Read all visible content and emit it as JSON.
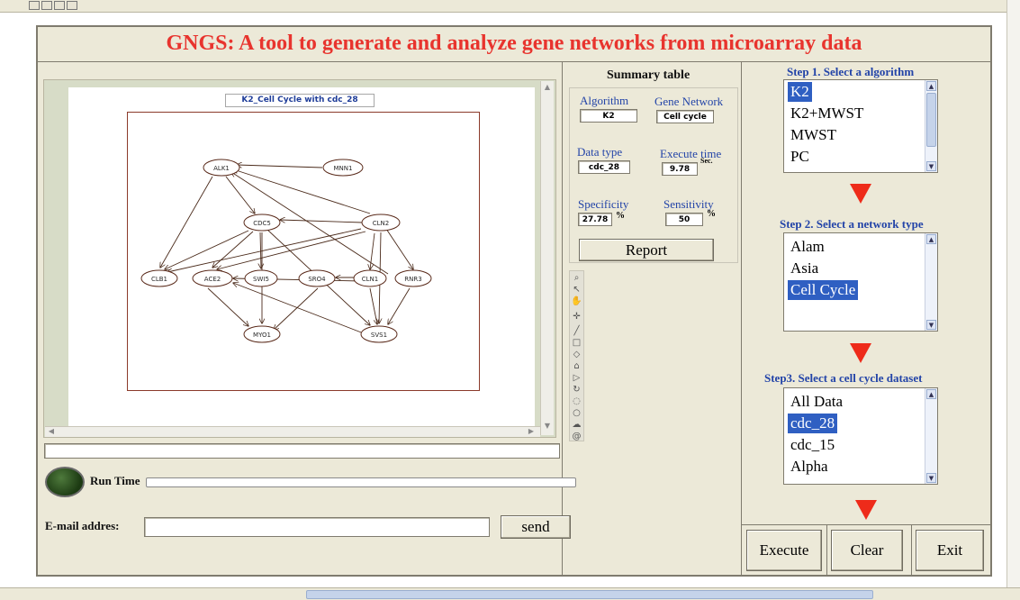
{
  "app": {
    "title": "GNGS: A tool to generate and analyze gene networks from microarray data"
  },
  "graph": {
    "title": "K2_Cell Cycle with cdc_28",
    "nodes": [
      "ALK1",
      "MNN1",
      "CDC5",
      "CLN2",
      "CLB1",
      "ACE2",
      "SWI5",
      "SRO4",
      "CLN1",
      "RNR3",
      "MYO1",
      "SVS1"
    ]
  },
  "run": {
    "run_time_label": "Run Time"
  },
  "email": {
    "label": "E-mail addres:",
    "value": "",
    "send_label": "send"
  },
  "summary": {
    "title": "Summary table",
    "algorithm_label": "Algorithm",
    "algorithm_value": "K2",
    "network_label": "Gene Network",
    "network_value": "Cell cycle",
    "datatype_label": "Data type",
    "datatype_value": "cdc_28",
    "exectime_label": "Execute time",
    "exectime_value": "9.78",
    "exectime_unit": "Sec.",
    "specificity_label": "Specificity",
    "specificity_value": "27.78",
    "specificity_unit": "%",
    "sensitivity_label": "Sensitivity",
    "sensitivity_value": "50",
    "sensitivity_unit": "%",
    "report_label": "Report"
  },
  "steps": {
    "step1_label": "Step 1. Select a algorithm",
    "algorithms": [
      "K2",
      "K2+MWST",
      "MWST",
      "PC"
    ],
    "algorithms_selected": "K2",
    "step2_label": "Step 2. Select a network type",
    "networks": [
      "Alam",
      "Asia",
      "Cell Cycle"
    ],
    "networks_selected": "Cell Cycle",
    "step3_label": "Step3. Select a cell cycle dataset",
    "datasets": [
      "All Data",
      "cdc_28",
      "cdc_15",
      "Alpha"
    ],
    "datasets_selected": "cdc_28"
  },
  "actions": {
    "execute_label": "Execute",
    "clear_label": "Clear",
    "exit_label": "Exit"
  },
  "colors": {
    "title": "#e8342e",
    "step_label": "#2344a8",
    "selection": "#2f5fc2",
    "arrow": "#ee2b1a"
  }
}
